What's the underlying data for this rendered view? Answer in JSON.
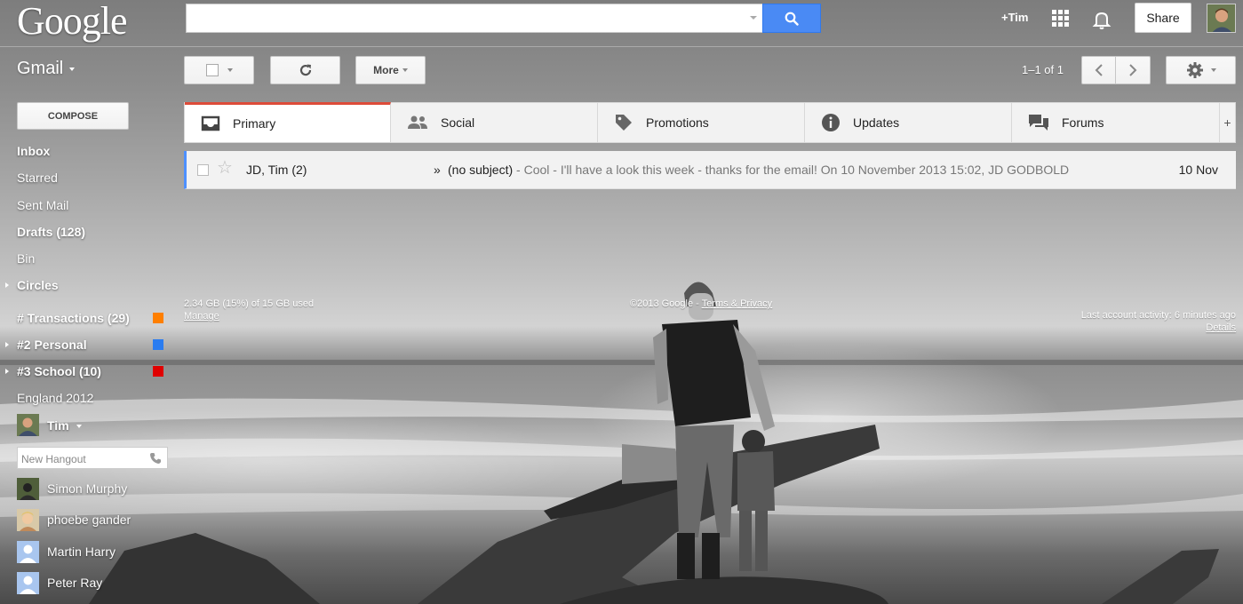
{
  "header": {
    "logo": "Google",
    "search_value": "",
    "plus_user": "+Tim",
    "share_label": "Share"
  },
  "app": {
    "name": "Gmail",
    "toolbar": {
      "more_label": "More",
      "pagination": "1–1 of 1"
    }
  },
  "sidebar": {
    "compose_label": "COMPOSE",
    "items": [
      {
        "label": "Inbox",
        "bold": true
      },
      {
        "label": "Starred",
        "bold": false
      },
      {
        "label": "Sent Mail",
        "bold": false
      },
      {
        "label": "Drafts (128)",
        "bold": true
      },
      {
        "label": "Bin",
        "bold": false
      },
      {
        "label": "Circles",
        "bold": true
      },
      {
        "label": "# Transactions (29)",
        "bold": true,
        "color": "#ff7f00"
      },
      {
        "label": "#2 Personal",
        "bold": true,
        "color": "#2a7cf0"
      },
      {
        "label": "#3 School (10)",
        "bold": true,
        "color": "#e00000"
      },
      {
        "label": "England 2012",
        "bold": false
      }
    ],
    "hangouts": {
      "user": "Tim",
      "input_placeholder": "New Hangout",
      "contacts": [
        "Simon Murphy",
        "phoebe gander",
        "Martin Harry",
        "Peter Ray"
      ]
    }
  },
  "tabs": [
    {
      "label": "Primary",
      "icon": "inbox-icon",
      "active": true
    },
    {
      "label": "Social",
      "icon": "people-icon",
      "active": false
    },
    {
      "label": "Promotions",
      "icon": "tag-icon",
      "active": false
    },
    {
      "label": "Updates",
      "icon": "info-icon",
      "active": false
    },
    {
      "label": "Forums",
      "icon": "forum-icon",
      "active": false
    }
  ],
  "tabs_add": "+",
  "messages": [
    {
      "sender": "JD, Tim (2)",
      "importance": "»",
      "subject": "(no subject)",
      "snippet": " - Cool - I'll have a look this week - thanks for the email! On 10 November 2013 15:02, JD GODBOLD",
      "date": "10 Nov"
    }
  ],
  "footer": {
    "storage": "2.34 GB (15%) of 15 GB used",
    "manage": "Manage",
    "copyright": "©2013 Google - ",
    "terms": "Terms & Privacy",
    "activity": "Last account activity: 6 minutes ago",
    "details": "Details"
  },
  "colors": {
    "accent_blue": "#4a8af4",
    "active_tab": "#dd4b39"
  }
}
